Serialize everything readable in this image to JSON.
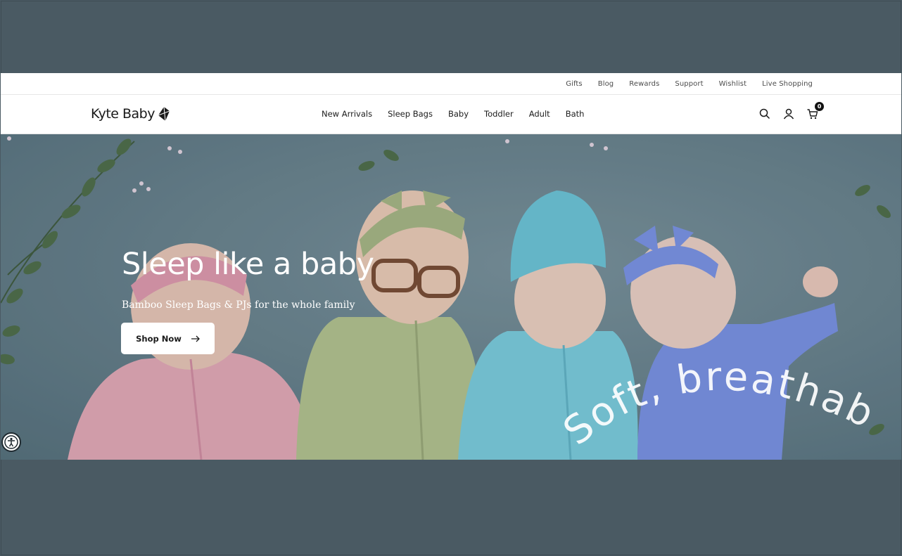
{
  "utility_nav": {
    "links": [
      "Gifts",
      "Blog",
      "Rewards",
      "Support",
      "Wishlist",
      "Live Shopping"
    ]
  },
  "header": {
    "logo_text": "Kyte Baby",
    "nav": [
      "New Arrivals",
      "Sleep Bags",
      "Baby",
      "Toddler",
      "Adult",
      "Bath"
    ],
    "icons": [
      "search-icon",
      "account-icon",
      "cart-icon"
    ],
    "cart_count": "0"
  },
  "hero": {
    "title": "Sleep like a baby",
    "subtitle": "Bamboo Sleep Bags & PJs for the whole family",
    "cta_label": "Shop Now",
    "cta_icon": "arrow-right-icon",
    "curved_text": "Soft, breathab",
    "colors": {
      "pink": "#e7aab8",
      "green": "#b5c48f",
      "teal": "#7ccfe0",
      "periwinkle": "#7a92e6"
    }
  },
  "accessibility": {
    "icon": "accessibility-icon"
  }
}
